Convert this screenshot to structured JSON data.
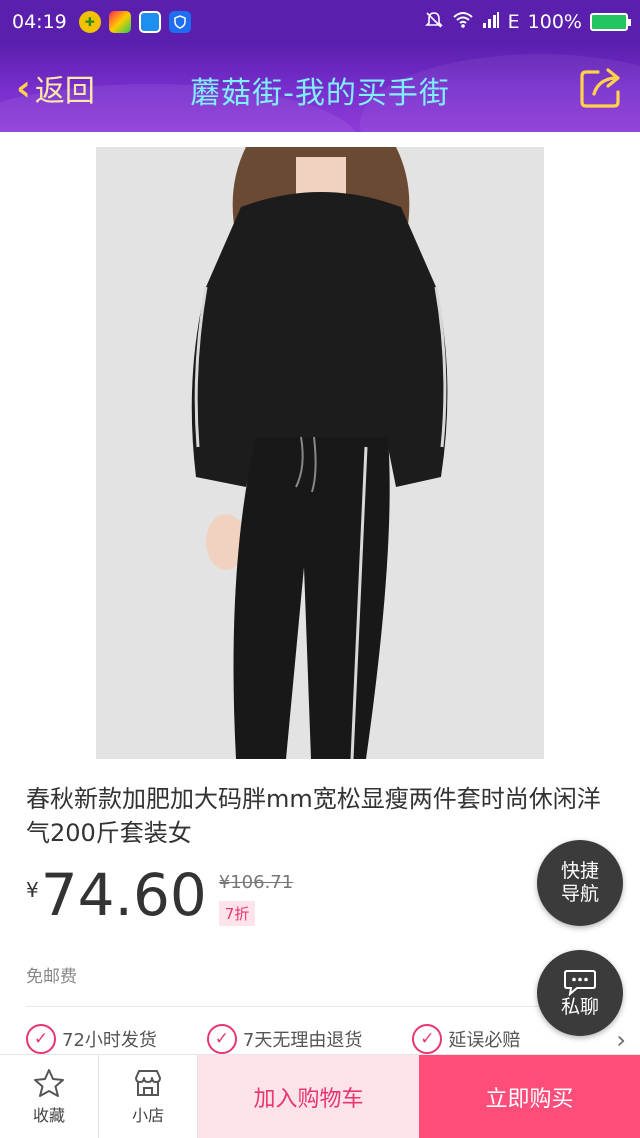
{
  "status_bar": {
    "time": "04:19",
    "network": "E",
    "battery": "100%",
    "icons": [
      "notification-off-icon",
      "wifi-icon",
      "signal-icon",
      "battery-charging-icon"
    ]
  },
  "header": {
    "back_label": "返回",
    "title": "蘑菇街-我的买手街",
    "share_icon": "share-icon"
  },
  "product": {
    "title": "春秋新款加肥加大码胖mm宽松显瘦两件套时尚休闲洋气200斤套装女",
    "currency": "¥",
    "price": "74.60",
    "original_price": "¥106.71",
    "discount": "7折",
    "shipping": "免邮费"
  },
  "guarantees": [
    "72小时发货",
    "7天无理由退货",
    "延误必赔"
  ],
  "floating": {
    "quick_nav": "快捷导航",
    "chat": "私聊"
  },
  "bottom_bar": {
    "favorite": "收藏",
    "shop": "小店",
    "add_to_cart": "加入购物车",
    "buy_now": "立即购买"
  },
  "colors": {
    "header_purple": "#5b1fae",
    "accent_pink": "#ff4d7a",
    "cart_bg": "#ffe3ea",
    "title_cyan": "#7ff0ff"
  }
}
